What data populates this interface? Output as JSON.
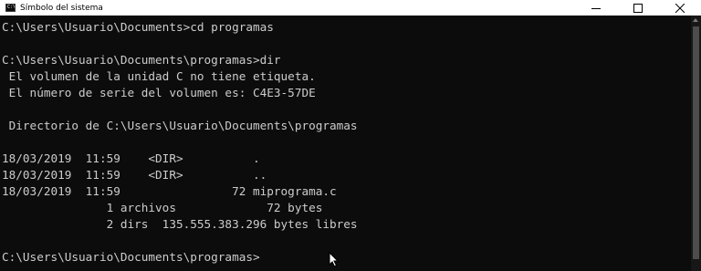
{
  "window": {
    "title": "Símbolo del sistema",
    "icon": "cmd-icon",
    "icon_text": "C:\\"
  },
  "console": {
    "lines": [
      "C:\\Users\\Usuario\\Documents>cd programas",
      "",
      "C:\\Users\\Usuario\\Documents\\programas>dir",
      " El volumen de la unidad C no tiene etiqueta.",
      " El número de serie del volumen es: C4E3-57DE",
      "",
      " Directorio de C:\\Users\\Usuario\\Documents\\programas",
      "",
      "18/03/2019  11:59    <DIR>          .",
      "18/03/2019  11:59    <DIR>          ..",
      "18/03/2019  11:59                72 miprograma.c",
      "               1 archivos             72 bytes",
      "               2 dirs  135.555.383.296 bytes libres",
      "",
      "C:\\Users\\Usuario\\Documents\\programas>"
    ]
  },
  "colors": {
    "console_background": "#0c0c0c",
    "console_text": "#cccccc",
    "titlebar": "#ffffff"
  }
}
